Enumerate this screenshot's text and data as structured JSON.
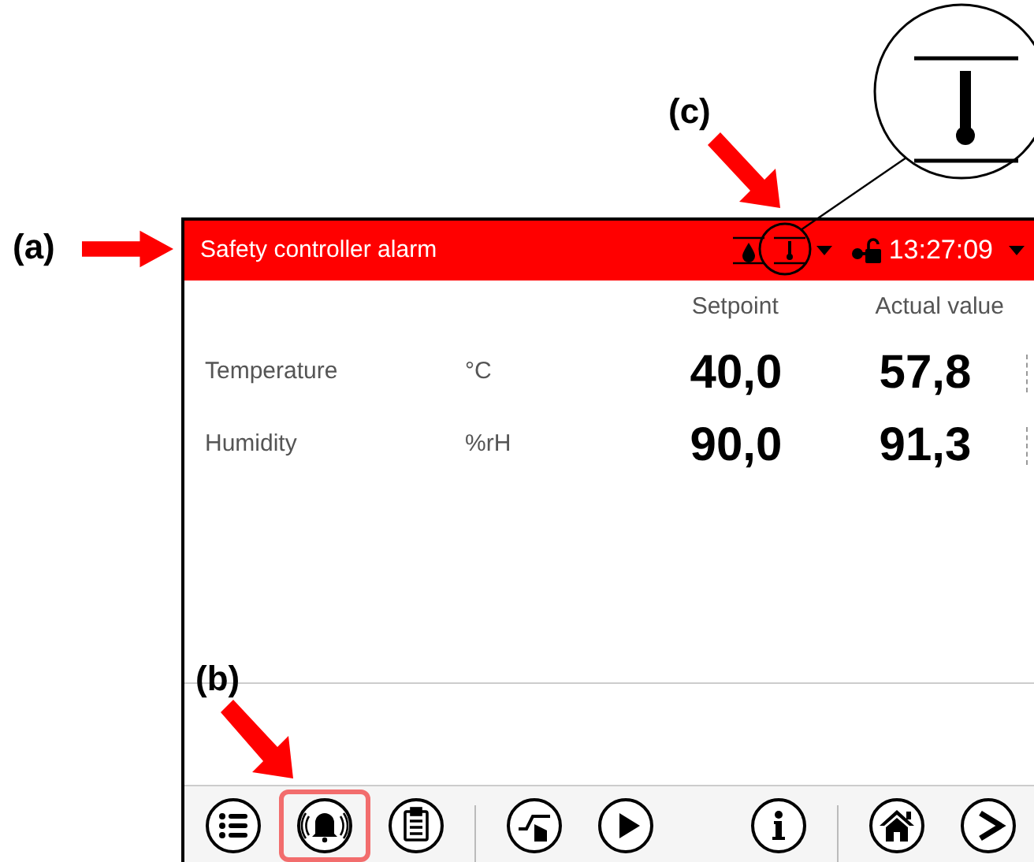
{
  "annotations": [
    {
      "label": "(a)"
    },
    {
      "label": "(b)"
    },
    {
      "label": "(c)"
    }
  ],
  "header": {
    "title": "Safety controller alarm",
    "time": "13:27:09"
  },
  "columns": [
    "Setpoint",
    "Actual value"
  ],
  "rows": [
    {
      "name": "Temperature",
      "unit": "°C",
      "setpoint": "40,0",
      "actual": "57,8"
    },
    {
      "name": "Humidity",
      "unit": "%rH",
      "setpoint": "90,0",
      "actual": "91,3"
    }
  ],
  "toolbar": {
    "left": [
      {
        "kind": "menu",
        "selected": false
      },
      {
        "kind": "alarm",
        "selected": true
      },
      {
        "kind": "notes",
        "selected": false
      },
      {
        "kind": "separator"
      },
      {
        "kind": "ramp",
        "selected": false
      },
      {
        "kind": "play",
        "selected": false
      }
    ],
    "right": [
      {
        "kind": "info",
        "selected": false
      },
      {
        "kind": "separator"
      },
      {
        "kind": "home",
        "selected": false
      },
      {
        "kind": "next",
        "selected": false
      }
    ]
  }
}
